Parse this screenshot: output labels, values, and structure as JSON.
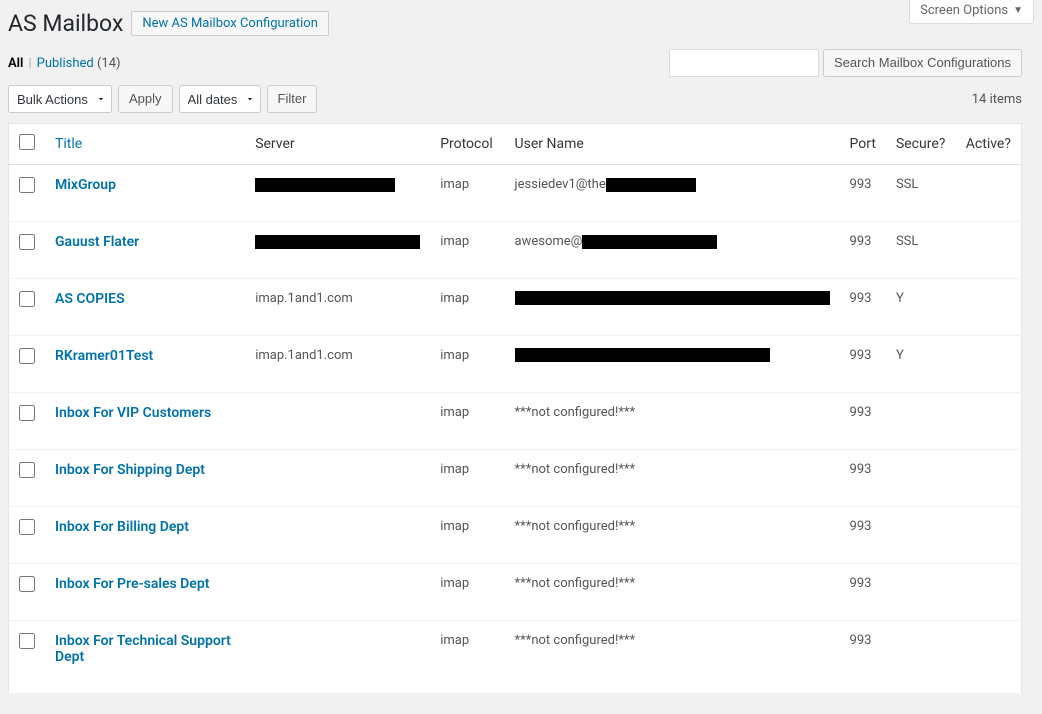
{
  "screen_options_label": "Screen Options",
  "page_title": "AS Mailbox",
  "add_new_label": "New AS Mailbox Configuration",
  "filters": {
    "all_label": "All",
    "published_label": "Published",
    "published_count": "(14)"
  },
  "search": {
    "placeholder": "",
    "button_label": "Search Mailbox Configurations"
  },
  "bulk_actions": {
    "label": "Bulk Actions",
    "apply_label": "Apply"
  },
  "date_filter": {
    "label": "All dates",
    "filter_label": "Filter"
  },
  "pagination": {
    "items_label": "14 items"
  },
  "columns": {
    "title": "Title",
    "server": "Server",
    "protocol": "Protocol",
    "username": "User Name",
    "port": "Port",
    "secure": "Secure?",
    "active": "Active?"
  },
  "rows": [
    {
      "title": "MixGroup",
      "server_redacted": "w140",
      "protocol": "imap",
      "username_prefix": "jessiedev1@the",
      "username_redacted": "w90",
      "port": "993",
      "secure": "SSL",
      "active": ""
    },
    {
      "title": "Gauust Flater",
      "server_redacted": "w165",
      "protocol": "imap",
      "username_prefix": "awesome@",
      "username_redacted": "w135",
      "port": "993",
      "secure": "SSL",
      "active": ""
    },
    {
      "title": "AS COPIES",
      "server": "imap.1and1.com",
      "protocol": "imap",
      "username_redacted_full": "w315",
      "port": "993",
      "secure": "Y",
      "active": ""
    },
    {
      "title": "RKramer01Test",
      "server": "imap.1and1.com",
      "protocol": "imap",
      "username_redacted_full": "w255",
      "port": "993",
      "secure": "Y",
      "active": ""
    },
    {
      "title": "Inbox For VIP Customers",
      "server": "",
      "protocol": "imap",
      "username": "***not configured!***",
      "port": "993",
      "secure": "",
      "active": ""
    },
    {
      "title": "Inbox For Shipping Dept",
      "server": "",
      "protocol": "imap",
      "username": "***not configured!***",
      "port": "993",
      "secure": "",
      "active": ""
    },
    {
      "title": "Inbox For Billing Dept",
      "server": "",
      "protocol": "imap",
      "username": "***not configured!***",
      "port": "993",
      "secure": "",
      "active": ""
    },
    {
      "title": "Inbox For Pre-sales Dept",
      "server": "",
      "protocol": "imap",
      "username": "***not configured!***",
      "port": "993",
      "secure": "",
      "active": ""
    },
    {
      "title": "Inbox For Technical Support Dept",
      "server": "",
      "protocol": "imap",
      "username": "***not configured!***",
      "port": "993",
      "secure": "",
      "active": ""
    }
  ]
}
